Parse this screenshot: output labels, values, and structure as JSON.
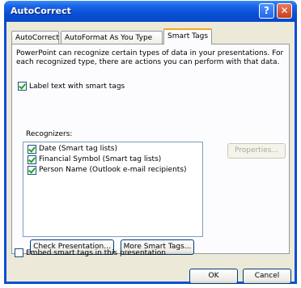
{
  "window": {
    "title": "AutoCorrect"
  },
  "titlebar": {
    "help_label": "?",
    "close_label": "✕"
  },
  "tabs": [
    {
      "label": "AutoCorrect"
    },
    {
      "label": "AutoFormat As You Type"
    },
    {
      "label": "Smart Tags"
    }
  ],
  "active_tab": "Smart Tags",
  "description": "PowerPoint can recognize certain types of data in your presentations. For each recognized type, there are actions you can perform with that data.",
  "label_text_option": {
    "label": "Label text with smart tags",
    "checked": true
  },
  "recognizers": {
    "heading": "Recognizers:",
    "items": [
      {
        "label": "Date (Smart tag lists)",
        "checked": true
      },
      {
        "label": "Financial Symbol (Smart tag lists)",
        "checked": true
      },
      {
        "label": "Person Name (Outlook e-mail recipients)",
        "checked": true
      }
    ]
  },
  "buttons": {
    "properties": "Properties...",
    "check_presentation": "Check Presentation...",
    "more_smart_tags": "More Smart Tags...",
    "ok": "OK",
    "cancel": "Cancel"
  },
  "embed_option": {
    "label": "Embed smart tags in this presentation",
    "checked": false
  }
}
